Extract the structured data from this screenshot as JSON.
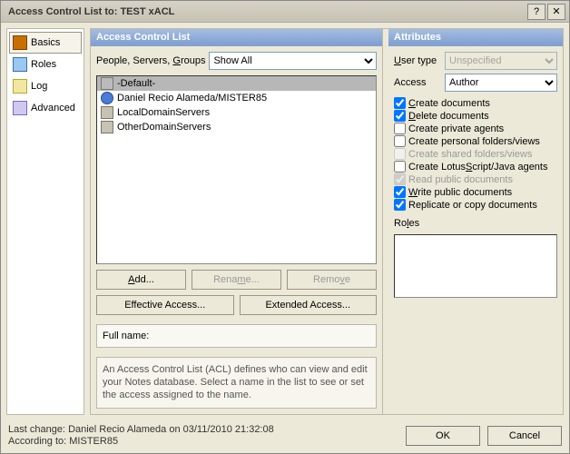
{
  "window": {
    "title": "Access Control List to: TEST xACL"
  },
  "sidebar": {
    "items": [
      {
        "label": "Basics",
        "icon": "ic-book",
        "selected": true
      },
      {
        "label": "Roles",
        "icon": "ic-roles",
        "selected": false
      },
      {
        "label": "Log",
        "icon": "ic-log",
        "selected": false
      },
      {
        "label": "Advanced",
        "icon": "ic-adv",
        "selected": false
      }
    ]
  },
  "acl": {
    "header": "Access Control List",
    "filter_label": "People, Servers, Groups",
    "filter_value": "Show All",
    "entries": [
      {
        "name": "-Default-",
        "icon": "ic-default",
        "selected": true
      },
      {
        "name": "Daniel Recio Alameda/MISTER85",
        "icon": "ic-person",
        "selected": false
      },
      {
        "name": "LocalDomainServers",
        "icon": "ic-server",
        "selected": false
      },
      {
        "name": "OtherDomainServers",
        "icon": "ic-server",
        "selected": false
      }
    ],
    "buttons": {
      "add": "Add...",
      "rename": "Rename...",
      "remove": "Remove",
      "effective": "Effective Access...",
      "extended": "Extended Access...",
      "rename_disabled": true,
      "remove_disabled": true
    },
    "full_name_label": "Full name:",
    "description": "An Access Control List (ACL) defines who can view and edit your Notes database.  Select a name in the list to see or set the access assigned to the name."
  },
  "attributes": {
    "header": "Attributes",
    "user_type_label": "User type",
    "user_type_value": "Unspecified",
    "user_type_disabled": true,
    "access_label": "Access",
    "access_value": "Author",
    "permissions": [
      {
        "label": "Create documents",
        "key": "C",
        "checked": true,
        "disabled": false
      },
      {
        "label": "Delete documents",
        "key": "D",
        "checked": true,
        "disabled": false
      },
      {
        "label": "Create private agents",
        "key": "",
        "checked": false,
        "disabled": false
      },
      {
        "label": "Create personal folders/views",
        "key": "",
        "checked": false,
        "disabled": false
      },
      {
        "label": "Create shared folders/views",
        "key": "",
        "checked": false,
        "disabled": true
      },
      {
        "label": "Create LotusScript/Java agents",
        "key": "S",
        "checked": false,
        "disabled": false
      },
      {
        "label": "Read public documents",
        "key": "",
        "checked": true,
        "disabled": true
      },
      {
        "label": "Write public documents",
        "key": "W",
        "checked": true,
        "disabled": false
      },
      {
        "label": "Replicate or copy documents",
        "key": "",
        "checked": true,
        "disabled": false
      }
    ],
    "roles_label": "Roles"
  },
  "footer": {
    "last_change_label": "Last change:",
    "last_change_value": "Daniel Recio Alameda on 03/11/2010 21:32:08",
    "according_to_label": "According to:",
    "according_to_value": "MISTER85",
    "ok": "OK",
    "cancel": "Cancel"
  }
}
